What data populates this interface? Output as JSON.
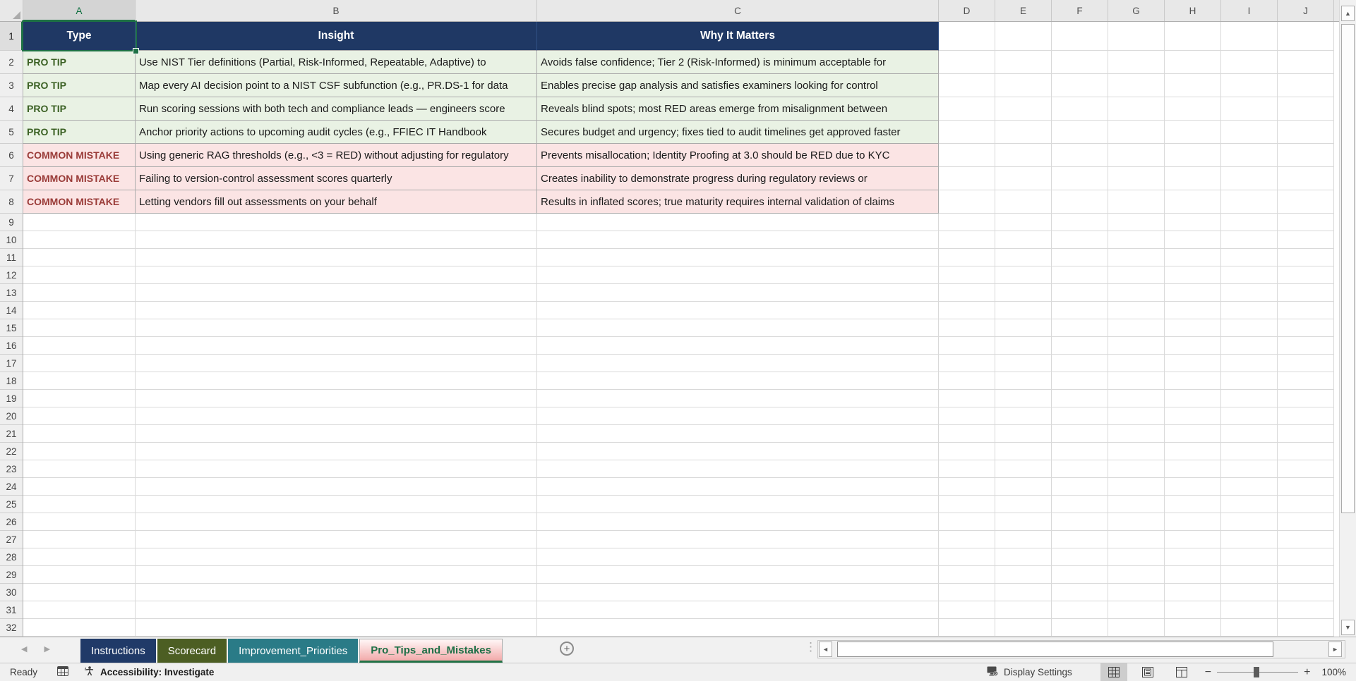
{
  "sheet": {
    "column_letters": [
      "A",
      "B",
      "C",
      "D",
      "E",
      "F",
      "G",
      "H",
      "I",
      "J"
    ],
    "row_numbers": [
      "1",
      "2",
      "3",
      "4",
      "5",
      "6",
      "7",
      "8",
      "9",
      "10",
      "11",
      "12",
      "13",
      "14",
      "15",
      "16",
      "17",
      "18",
      "19",
      "20",
      "21",
      "22",
      "23",
      "24",
      "25",
      "26",
      "27",
      "28",
      "29",
      "30",
      "31",
      "32"
    ],
    "selected_cell": {
      "column": "A",
      "row": "1"
    }
  },
  "table": {
    "headers": [
      "Type",
      "Insight",
      "Why It Matters"
    ],
    "rows": [
      {
        "kind": "tip",
        "type": "PRO TIP",
        "insight": "Use NIST Tier definitions (Partial, Risk-Informed, Repeatable, Adaptive) to",
        "why": "Avoids false confidence; Tier 2 (Risk-Informed) is minimum acceptable for"
      },
      {
        "kind": "tip",
        "type": "PRO TIP",
        "insight": "Map every AI decision point to a NIST CSF subfunction (e.g., PR.DS-1 for data",
        "why": "Enables precise gap analysis and satisfies examiners looking for control"
      },
      {
        "kind": "tip",
        "type": "PRO TIP",
        "insight": "Run scoring sessions with both tech and compliance leads — engineers score",
        "why": "Reveals blind spots; most RED areas emerge from misalignment between"
      },
      {
        "kind": "tip",
        "type": "PRO TIP",
        "insight": "Anchor priority actions to upcoming audit cycles (e.g., FFIEC IT Handbook",
        "why": "Secures budget and urgency; fixes tied to audit timelines get approved faster"
      },
      {
        "kind": "mistake",
        "type": "COMMON MISTAKE",
        "insight": "Using generic RAG thresholds (e.g., <3 = RED) without adjusting for regulatory",
        "why": "Prevents misallocation; Identity Proofing at 3.0 should be RED due to KYC"
      },
      {
        "kind": "mistake",
        "type": "COMMON MISTAKE",
        "insight": "Failing to version-control assessment scores quarterly",
        "why": "Creates inability to demonstrate progress during regulatory reviews or"
      },
      {
        "kind": "mistake",
        "type": "COMMON MISTAKE",
        "insight": "Letting vendors fill out assessments on your behalf",
        "why": "Results in inflated scores; true maturity requires internal validation of claims"
      }
    ]
  },
  "tabs": [
    {
      "label": "Instructions",
      "active": false,
      "color": "#203A68"
    },
    {
      "label": "Scorecard",
      "active": false,
      "color": "#4C5E23"
    },
    {
      "label": "Improvement_Priorities",
      "active": false,
      "color": "#2A7B87"
    },
    {
      "label": "Pro_Tips_and_Mistakes",
      "active": true,
      "color": "#F2AAAA"
    }
  ],
  "status_bar": {
    "mode": "Ready",
    "accessibility": "Accessibility: Investigate",
    "display_settings": "Display Settings",
    "zoom_level": "100%"
  },
  "colors": {
    "header_fill": "#1F3864",
    "tip_fill": "#E9F2E4",
    "tip_text": "#3A6023",
    "mistake_fill": "#FBE4E4",
    "mistake_text": "#9A3B38",
    "selection_green": "#1E7145",
    "active_tab_text": "#1E6F46"
  }
}
